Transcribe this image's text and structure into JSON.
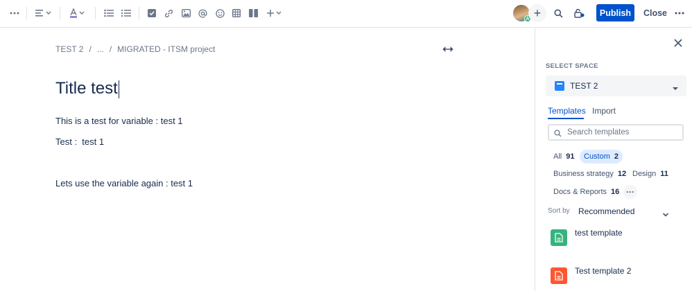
{
  "toolbar": {
    "icons": [
      "more-icon",
      "align-icon",
      "text-color-icon",
      "bullet-list-icon",
      "numbered-list-icon",
      "task-icon",
      "link-icon",
      "image-icon",
      "mention-icon",
      "emoji-icon",
      "table-icon",
      "layout-icon",
      "insert-icon"
    ],
    "avatar_badge": "A",
    "add_symbol": "+",
    "publish_label": "Publish",
    "close_label": "Close",
    "more_label": "…"
  },
  "breadcrumb": [
    "TEST 2",
    "/",
    "...",
    "/",
    "MIGRATED - ITSM project"
  ],
  "editor": {
    "title": "Title test",
    "paragraphs": [
      "This is a test for variable : test 1",
      "Test :  test 1",
      "Lets use the variable again : test 1"
    ]
  },
  "panel": {
    "select_space_label": "SELECT SPACE",
    "space_name": "TEST 2",
    "tabs": [
      "Templates",
      "Import"
    ],
    "search_placeholder": "Search templates",
    "chips": [
      {
        "label": "All",
        "count": "91",
        "selected": false
      },
      {
        "label": "Custom",
        "count": "2",
        "selected": true
      },
      {
        "label": "Business strategy",
        "count": "12",
        "selected": false
      },
      {
        "label": "Design",
        "count": "11",
        "selected": false
      },
      {
        "label": "Docs & Reports",
        "count": "16",
        "selected": false
      }
    ],
    "more_chip": "···",
    "sort_label": "Sort by",
    "sort_value": "Recommended",
    "templates": [
      {
        "name": "test template",
        "color": "#36b37e"
      },
      {
        "name": "Test template 2",
        "color": "#ff5630"
      }
    ]
  },
  "colors": {
    "primary": "#0052cc",
    "chip_selected_bg": "#deebff"
  }
}
